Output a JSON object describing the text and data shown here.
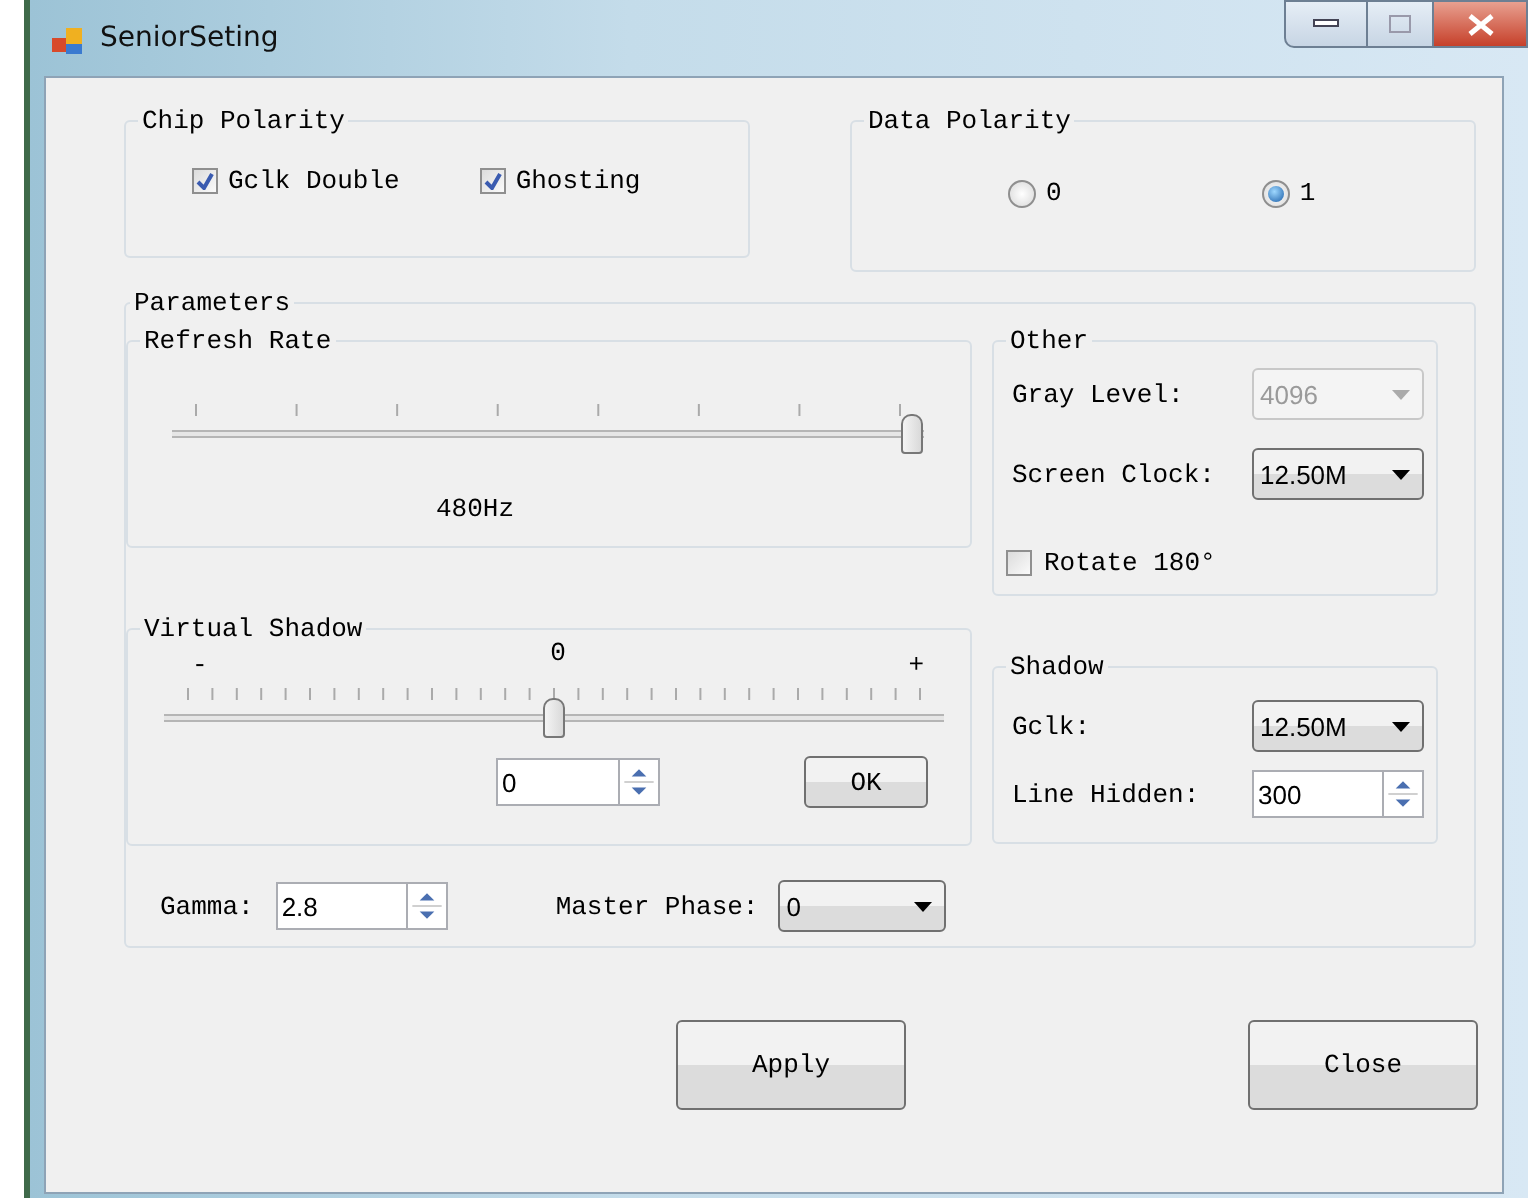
{
  "window": {
    "title": "SeniorSeting"
  },
  "chip_polarity": {
    "title": "Chip Polarity",
    "checkboxes": [
      {
        "label": "Gclk Double",
        "checked": true
      },
      {
        "label": "Ghosting",
        "checked": true
      }
    ]
  },
  "data_polarity": {
    "title": "Data Polarity",
    "options": [
      {
        "label": "0",
        "selected": false
      },
      {
        "label": "1",
        "selected": true
      }
    ]
  },
  "parameters": {
    "title": "Parameters",
    "refresh_rate": {
      "title": "Refresh Rate",
      "level": 1,
      "reading": "480Hz"
    },
    "virtual_shadow": {
      "title": "Virtual Shadow",
      "minus": "-",
      "value_label": "0",
      "plus": "+",
      "level": 0.5,
      "spin_value": "0",
      "ok": "OK"
    },
    "other": {
      "title": "Other",
      "fields": [
        {
          "label": "Gray Level:",
          "value": "4096",
          "disabled": true
        },
        {
          "label": "Screen Clock:",
          "value": "12.50M",
          "disabled": false
        }
      ],
      "rotate": {
        "label": "Rotate 180°",
        "checked": false
      }
    },
    "shadow": {
      "title": "Shadow",
      "gclk": {
        "label": "Gclk:",
        "value": "12.50M"
      },
      "line_hidden": {
        "label": "Line Hidden:",
        "value": "300"
      }
    },
    "gamma": {
      "label": "Gamma:",
      "value": "2.8"
    },
    "master_phase": {
      "label": "Master Phase:",
      "value": "0"
    }
  },
  "buttons": [
    {
      "label": "Apply"
    },
    {
      "label": "Close"
    }
  ]
}
